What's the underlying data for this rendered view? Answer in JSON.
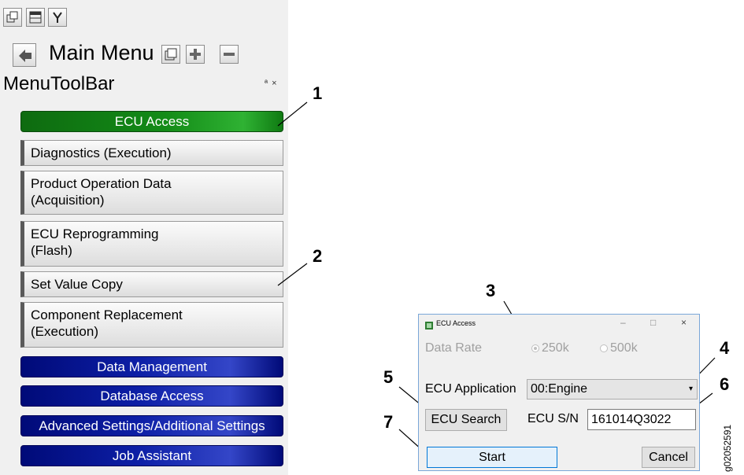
{
  "toolbar": {
    "icons": [
      "restore-icon",
      "window-layout-icon",
      "tools-icon"
    ]
  },
  "main_menu": {
    "label": "Main Menu",
    "icons": [
      "back-icon",
      "window-icon",
      "add-icon",
      "remove-icon"
    ]
  },
  "menutoolbar": {
    "title": "MenuToolBar",
    "controls": "ª ×"
  },
  "menu_items": [
    {
      "label": "ECU Access",
      "style": "green"
    },
    {
      "label": "Diagnostics (Execution)",
      "style": "gray"
    },
    {
      "label": "Product Operation Data\n(Acquisition)",
      "style": "gray"
    },
    {
      "label": "ECU Reprogramming\n(Flash)",
      "style": "gray"
    },
    {
      "label": "Set Value Copy",
      "style": "gray"
    },
    {
      "label": "Component Replacement\n(Execution)",
      "style": "gray"
    },
    {
      "label": "Data Management",
      "style": "blue"
    },
    {
      "label": "Database Access",
      "style": "blue"
    },
    {
      "label": "Advanced Settings/Additional Settings",
      "style": "blue"
    },
    {
      "label": "Job Assistant",
      "style": "blue"
    }
  ],
  "callouts": [
    "1",
    "2",
    "3",
    "4",
    "5",
    "6",
    "7"
  ],
  "dialog": {
    "title": "ECU Access",
    "controls": {
      "minimize": "–",
      "maximize": "□",
      "close": "×"
    },
    "data_rate_label": "Data Rate",
    "rate_options": [
      "250k",
      "500k"
    ],
    "rate_selected": "250k",
    "ecu_application_label": "ECU Application",
    "ecu_application_value": "00:Engine",
    "ecu_search_button": "ECU Search",
    "ecu_sn_label": "ECU S/N",
    "ecu_sn_value": "161014Q3022",
    "start_button": "Start",
    "cancel_button": "Cancel"
  },
  "figure_id": "g02052591",
  "colors": {
    "green_accent": "#138b17",
    "blue_accent": "#0d1fa6",
    "dialog_border": "#7aa7d8"
  }
}
